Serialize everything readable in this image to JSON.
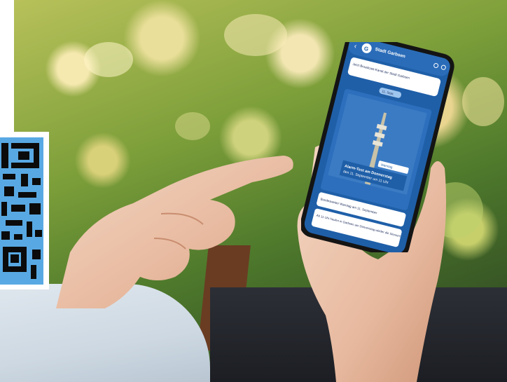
{
  "qr": {
    "icon": "qr-code-icon"
  },
  "phone": {
    "channel_name": "Stadt Garbsen",
    "pinned_message": "Jetzt Broadcast-Kanal der Stadt Garbsen",
    "date_chip": "11. Sept.",
    "post_caption_line1": "Alarm-Test am Donnerstag",
    "post_caption_line2": "den 11. September um 11 Uhr",
    "post_tag": "Warntag",
    "message_1": "Bundesweiter Warntag am 11. September",
    "message_2": "Ab 11 Uhr heulen in Garbsen am Donnerstag wieder die Sirenen!",
    "colors": {
      "screen": "#1f5fa8",
      "accent": "#4a90d9",
      "bubble": "#ffffff",
      "frame": "#141414"
    },
    "icons": [
      "back-arrow-icon",
      "logo-icon",
      "bell-icon",
      "menu-icon",
      "siren-tower-icon"
    ]
  }
}
